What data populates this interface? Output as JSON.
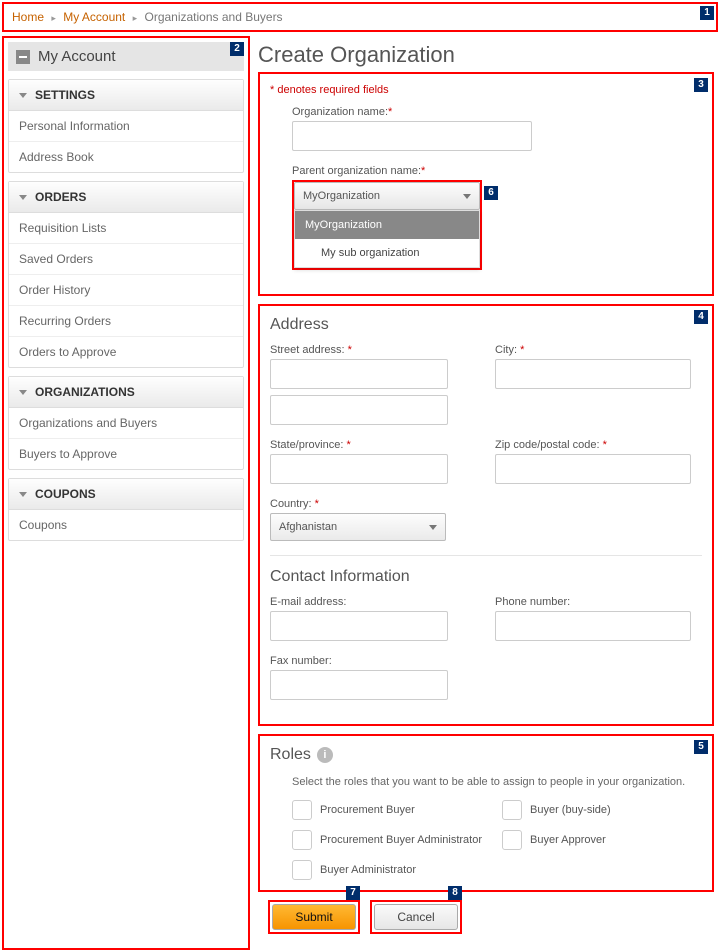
{
  "breadcrumb": {
    "home": "Home",
    "my_account": "My Account",
    "current": "Organizations and Buyers"
  },
  "sidebar": {
    "title": "My Account",
    "settings": {
      "header": "SETTINGS",
      "items": [
        "Personal Information",
        "Address Book"
      ]
    },
    "orders": {
      "header": "ORDERS",
      "items": [
        "Requisition Lists",
        "Saved Orders",
        "Order History",
        "Recurring Orders",
        "Orders to Approve"
      ]
    },
    "organizations": {
      "header": "ORGANIZATIONS",
      "items": [
        "Organizations and Buyers",
        "Buyers to Approve"
      ]
    },
    "coupons": {
      "header": "COUPONS",
      "items": [
        "Coupons"
      ]
    }
  },
  "page": {
    "title": "Create Organization",
    "required_note": "* denotes required fields"
  },
  "org_form": {
    "org_name_label": "Organization name:",
    "parent_label": "Parent organization name:",
    "parent_selected": "MyOrganization",
    "parent_options": [
      "MyOrganization",
      "My sub organization"
    ]
  },
  "address": {
    "title": "Address",
    "street_label": "Street address:",
    "city_label": "City:",
    "state_label": "State/province:",
    "zip_label": "Zip code/postal code:",
    "country_label": "Country:",
    "country_value": "Afghanistan"
  },
  "contact": {
    "title": "Contact Information",
    "email_label": "E-mail address:",
    "phone_label": "Phone number:",
    "fax_label": "Fax number:"
  },
  "roles": {
    "title": "Roles",
    "hint": "Select the roles that you want to be able to assign to people in your organization.",
    "options": [
      "Procurement Buyer",
      "Buyer (buy-side)",
      "Procurement Buyer Administrator",
      "Buyer Approver",
      "Buyer Administrator"
    ]
  },
  "buttons": {
    "submit": "Submit",
    "cancel": "Cancel"
  },
  "callouts": [
    "1",
    "2",
    "3",
    "4",
    "5",
    "6",
    "7",
    "8"
  ]
}
